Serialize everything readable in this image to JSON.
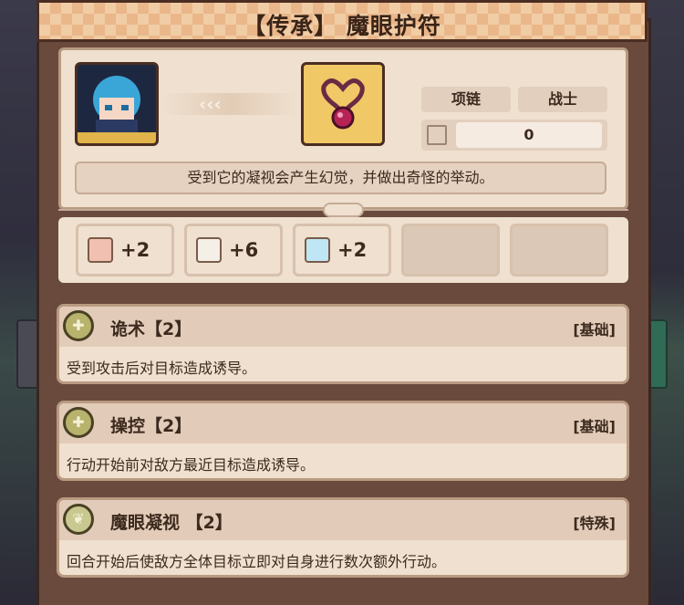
{
  "title": "【传承】 魔眼护符",
  "portrait_icon": "hero-portrait-icon",
  "transfer_arrows": "‹‹‹",
  "item_icon": "amulet-icon",
  "tags": [
    "项链",
    "战士"
  ],
  "slot": {
    "icon": "slot-icon",
    "value": "0"
  },
  "description": "受到它的凝视会产生幻觉，并做出奇怪的举动。",
  "stats": [
    {
      "icon": "strength-fist-icon",
      "value": "+2"
    },
    {
      "icon": "book-icon",
      "value": "+6"
    },
    {
      "icon": "water-drop-icon",
      "value": "+2"
    }
  ],
  "skills": [
    {
      "icon": "skill-rune-icon",
      "name": "诡术【2】",
      "type": "[基础]",
      "desc": "受到攻击后对目标造成诱导。"
    },
    {
      "icon": "skill-rune-icon",
      "name": "操控【2】",
      "type": "[基础]",
      "desc": "行动开始前对敌方最近目标造成诱导。"
    },
    {
      "icon": "skill-leaf-icon",
      "name": "魔眼凝视 【2】",
      "type": "[特殊]",
      "desc": "回合开始后使敌方全体目标立即对自身进行数次额外行动。"
    }
  ],
  "colors": {
    "background": "#2b2a36",
    "panel": "#6a4a3c",
    "card": "#efe0cf",
    "banner": "#f1cda5",
    "text": "#3d2a1e",
    "skill_icon": "#b7b26c"
  }
}
